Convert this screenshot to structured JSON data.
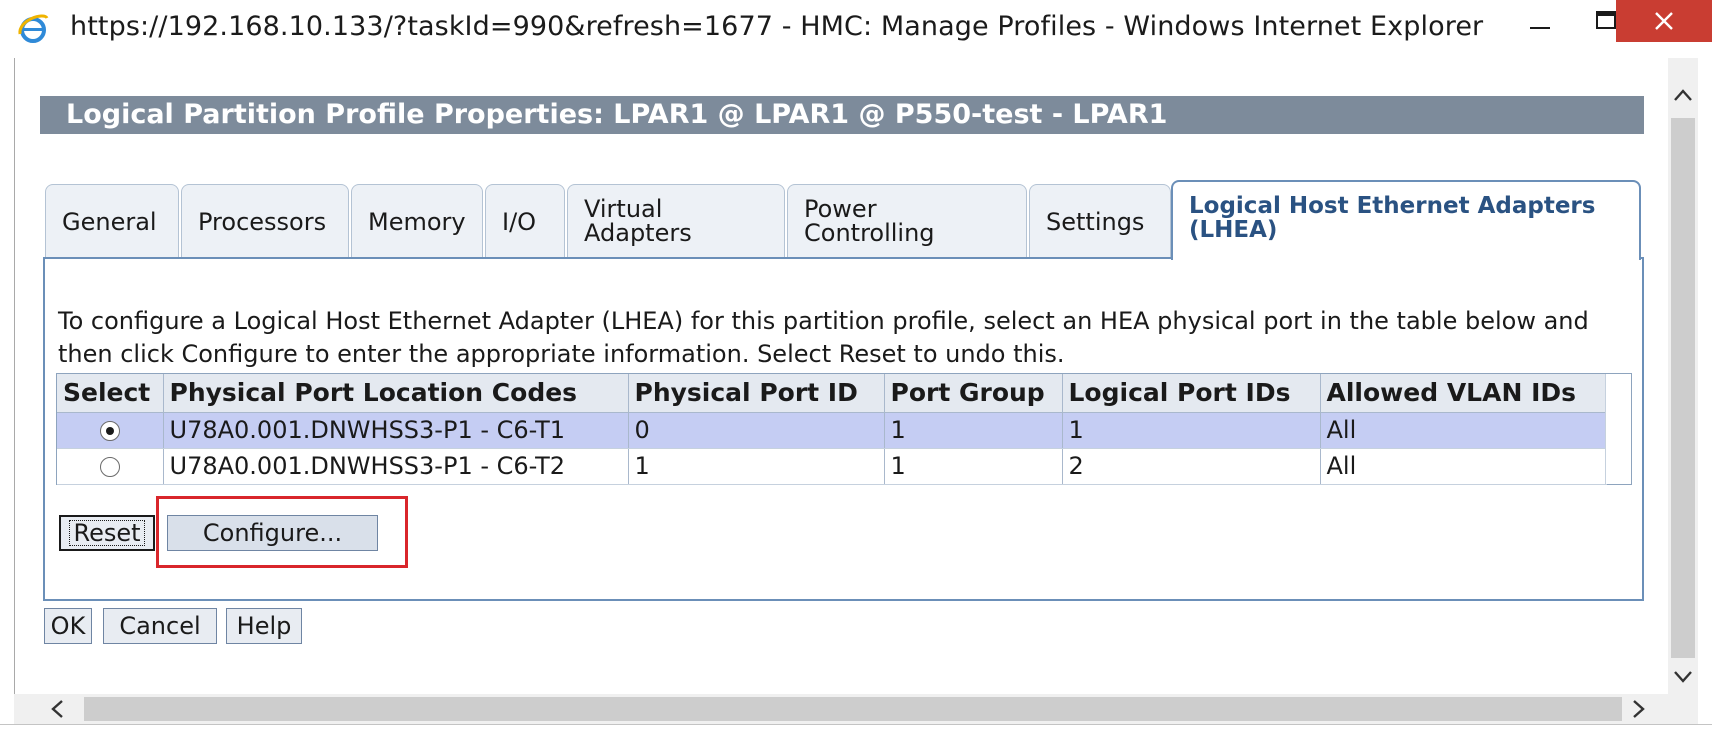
{
  "window": {
    "title": "https://192.168.10.133/?taskId=990&refresh=1677 - HMC: Manage Profiles - Windows Internet Explorer",
    "icon": "ie-icon"
  },
  "dialog": {
    "title": "Logical Partition Profile Properties: LPAR1 @ LPAR1 @ P550-test - LPAR1"
  },
  "tabs": [
    {
      "label_line1": "General",
      "label_line2": ""
    },
    {
      "label_line1": "Processors",
      "label_line2": ""
    },
    {
      "label_line1": "Memory",
      "label_line2": ""
    },
    {
      "label_line1": "I/O",
      "label_line2": ""
    },
    {
      "label_line1": "Virtual",
      "label_line2": "Adapters"
    },
    {
      "label_line1": "Power",
      "label_line2": "Controlling"
    },
    {
      "label_line1": "Settings",
      "label_line2": ""
    },
    {
      "label_line1": "Logical Host Ethernet Adapters",
      "label_line2": "(LHEA)",
      "active": true
    }
  ],
  "lhea": {
    "instructions": "To configure a Logical Host Ethernet Adapter (LHEA) for this partition profile, select an HEA physical port in the table below and then click Configure to enter the appropriate information. Select Reset to undo this.",
    "columns": [
      "Select",
      "Physical Port Location Codes",
      "Physical Port ID",
      "Port Group",
      "Logical Port IDs",
      "Allowed VLAN IDs"
    ],
    "rows": [
      {
        "selected": true,
        "location": "U78A0.001.DNWHSS3-P1 - C6-T1",
        "port_id": "0",
        "port_group": "1",
        "logical_port_ids": "1",
        "vlan_ids": "All"
      },
      {
        "selected": false,
        "location": "U78A0.001.DNWHSS3-P1 - C6-T2",
        "port_id": "1",
        "port_group": "1",
        "logical_port_ids": "2",
        "vlan_ids": "All"
      }
    ],
    "reset_label": "Reset",
    "configure_label": "Configure..."
  },
  "footer": {
    "ok_label": "OK",
    "cancel_label": "Cancel",
    "help_label": "Help"
  },
  "colors": {
    "header_bg": "#7d8b9b",
    "tab_border": "#6b8fb8",
    "active_tab_text": "#2a5282",
    "selected_row": "#c5cdf3",
    "highlight_box": "#d9262b",
    "close_button": "#c93d32"
  }
}
